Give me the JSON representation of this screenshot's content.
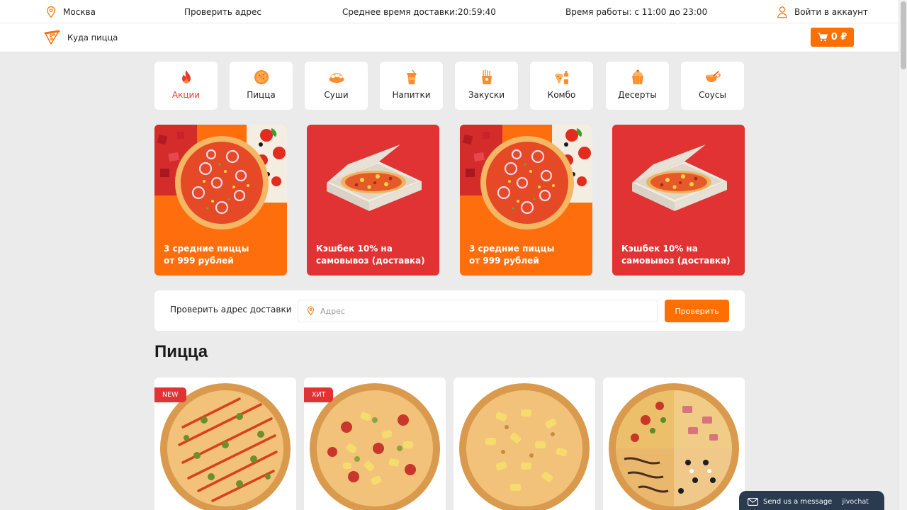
{
  "header": {
    "city": "Москва",
    "check_address": "Проверить адрес",
    "delivery_time_label": "Среднее время доставки:",
    "delivery_time_value": "20:59:40",
    "work_hours": "Время работы: с 11:00 до 23:00",
    "login": "Войти в аккаунт",
    "logo_text": "Куда пицца",
    "cart_total": "0 ₽"
  },
  "categories": [
    {
      "label": "Акции",
      "icon": "flame-icon",
      "active": true
    },
    {
      "label": "Пицца",
      "icon": "pizza-icon"
    },
    {
      "label": "Суши",
      "icon": "sushi-icon"
    },
    {
      "label": "Напитки",
      "icon": "drink-icon"
    },
    {
      "label": "Закуски",
      "icon": "fries-icon"
    },
    {
      "label": "Комбо",
      "icon": "combo-icon"
    },
    {
      "label": "Десерты",
      "icon": "dessert-icon"
    },
    {
      "label": "Соусы",
      "icon": "sauce-icon"
    }
  ],
  "banners": [
    {
      "line1": "3 средние пиццы",
      "line2": "от 999 рублей",
      "image": "pizza-promo"
    },
    {
      "line1": "Кэшбек 10% на",
      "line2": "самовывоз (доставка)",
      "image": "pizza-box"
    },
    {
      "line1": "3 средние пиццы",
      "line2": "от 999 рублей",
      "image": "pizza-promo"
    },
    {
      "line1": "Кэшбек 10% на",
      "line2": "самовывоз (доставка)",
      "image": "pizza-box"
    }
  ],
  "address_check": {
    "label": "Проверить адрес доставки",
    "placeholder": "Адрес",
    "button": "Проверить"
  },
  "section_title": "Пицца",
  "products": [
    {
      "badge": "NEW",
      "image": "pizza-jalapeno"
    },
    {
      "badge": "ХИТ",
      "image": "pizza-pineapple-pepperoni"
    },
    {
      "badge": "",
      "image": "pizza-pineapple"
    },
    {
      "badge": "",
      "image": "pizza-four-quarters"
    }
  ],
  "chat": {
    "label": "Send us a message",
    "brand": "jivochat"
  },
  "colors": {
    "accent": "#ff6f00",
    "red": "#e13334",
    "orange_banner": "#ff6e0d",
    "background": "#ebebeb"
  }
}
